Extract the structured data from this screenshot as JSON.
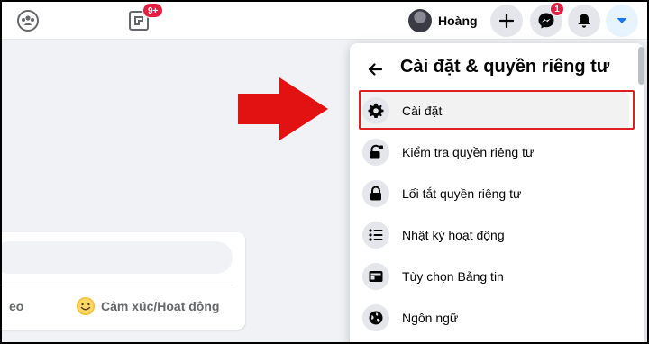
{
  "topbar": {
    "gaming_badge": "9+",
    "profile_name": "Hoàng",
    "messenger_badge": "1"
  },
  "composer": {
    "video_label": "eo",
    "feeling_label": "Cảm xúc/Hoạt động"
  },
  "menu": {
    "title": "Cài đặt & quyền riêng tư",
    "items": [
      {
        "label": "Cài đặt",
        "icon": "gear-icon"
      },
      {
        "label": "Kiểm tra quyền riêng tư",
        "icon": "lock-check-icon"
      },
      {
        "label": "Lối tắt quyền riêng tư",
        "icon": "lock-icon"
      },
      {
        "label": "Nhật ký hoạt động",
        "icon": "list-icon"
      },
      {
        "label": "Tùy chọn Bảng tin",
        "icon": "news-feed-icon"
      },
      {
        "label": "Ngôn ngữ",
        "icon": "globe-icon"
      }
    ]
  },
  "colors": {
    "accent": "#1877f2",
    "highlight": "#e02020",
    "badge": "#e41e3f"
  }
}
